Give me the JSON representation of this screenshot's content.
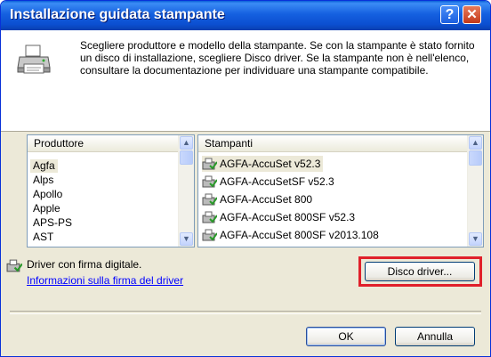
{
  "window": {
    "title": "Installazione guidata stampante",
    "help_label": "?",
    "close_label": "✕"
  },
  "header": {
    "icon": "printer-icon",
    "description": "Scegliere produttore e modello della stampante. Se con la stampante è stato fornito un disco di installazione, scegliere Disco driver. Se la stampante non è nell'elenco, consultare la documentazione per individuare una stampante compatibile."
  },
  "manufacturers": {
    "header": "Produttore",
    "items": [
      "Agfa",
      "Alps",
      "Apollo",
      "Apple",
      "APS-PS",
      "AST"
    ],
    "selected": "Agfa"
  },
  "printers": {
    "header": "Stampanti",
    "items": [
      "AGFA-AccuSet v52.3",
      "AGFA-AccuSetSF v52.3",
      "AGFA-AccuSet 800",
      "AGFA-AccuSet 800SF v52.3",
      "AGFA-AccuSet 800SF v2013.108"
    ],
    "selected": "AGFA-AccuSet v52.3"
  },
  "signature": {
    "text": "Driver con firma digitale.",
    "link": "Informazioni sulla firma del driver",
    "icon": "signed-driver-icon"
  },
  "buttons": {
    "have_disk": "Disco driver...",
    "ok": "OK",
    "cancel": "Annulla"
  },
  "colors": {
    "titlebar": "#0a5fd8",
    "highlight": "#e0202a",
    "link": "#0000ff",
    "dialog_bg": "#ece9d8"
  }
}
